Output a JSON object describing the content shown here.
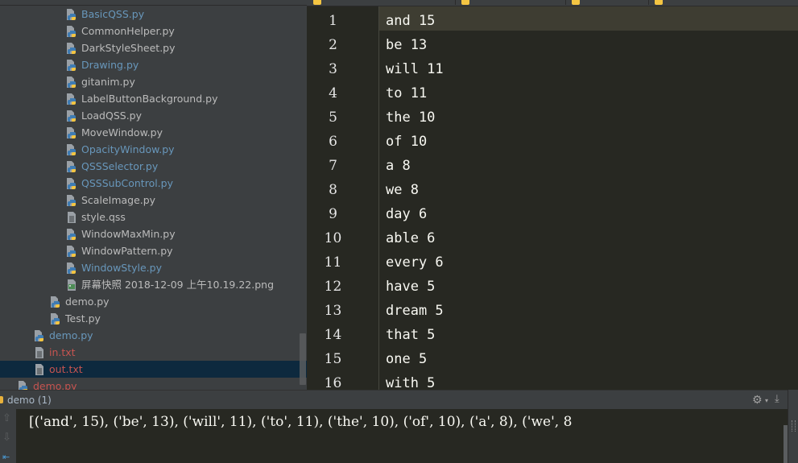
{
  "project_tree": {
    "items": [
      {
        "label": "BasicQSS.py",
        "icon": "python-file-icon",
        "status": "modified",
        "depth": 3
      },
      {
        "label": "CommonHelper.py",
        "icon": "python-file-icon",
        "status": "default",
        "depth": 3
      },
      {
        "label": "DarkStyleSheet.py",
        "icon": "python-file-icon",
        "status": "default",
        "depth": 3
      },
      {
        "label": "Drawing.py",
        "icon": "python-file-icon",
        "status": "modified",
        "depth": 3
      },
      {
        "label": "gitanim.py",
        "icon": "python-file-icon",
        "status": "default",
        "depth": 3
      },
      {
        "label": "LabelButtonBackground.py",
        "icon": "python-file-icon",
        "status": "default",
        "depth": 3
      },
      {
        "label": "LoadQSS.py",
        "icon": "python-file-icon",
        "status": "default",
        "depth": 3
      },
      {
        "label": "MoveWindow.py",
        "icon": "python-file-icon",
        "status": "default",
        "depth": 3
      },
      {
        "label": "OpacityWindow.py",
        "icon": "python-file-icon",
        "status": "modified",
        "depth": 3
      },
      {
        "label": "QSSSelector.py",
        "icon": "python-file-icon",
        "status": "modified",
        "depth": 3
      },
      {
        "label": "QSSSubControl.py",
        "icon": "python-file-icon",
        "status": "modified",
        "depth": 3
      },
      {
        "label": "ScaleImage.py",
        "icon": "python-file-icon",
        "status": "default",
        "depth": 3
      },
      {
        "label": "style.qss",
        "icon": "text-file-icon",
        "status": "default",
        "depth": 3
      },
      {
        "label": "WindowMaxMin.py",
        "icon": "python-file-icon",
        "status": "default",
        "depth": 3
      },
      {
        "label": "WindowPattern.py",
        "icon": "python-file-icon",
        "status": "default",
        "depth": 3
      },
      {
        "label": "WindowStyle.py",
        "icon": "python-file-icon",
        "status": "modified",
        "depth": 3
      },
      {
        "label": "屏幕快照 2018-12-09 上午10.19.22.png",
        "icon": "image-file-icon",
        "status": "default",
        "depth": 3
      },
      {
        "label": "demo.py",
        "icon": "python-file-icon",
        "status": "default",
        "depth": 2
      },
      {
        "label": "Test.py",
        "icon": "python-file-icon",
        "status": "default",
        "depth": 2
      },
      {
        "label": "demo.py",
        "icon": "python-file-icon",
        "status": "modified",
        "depth": 1
      },
      {
        "label": "in.txt",
        "icon": "text-file-icon",
        "status": "untracked",
        "depth": 1
      },
      {
        "label": "out.txt",
        "icon": "text-file-icon",
        "status": "untracked",
        "depth": 1,
        "selected": true
      },
      {
        "label": "demo.py",
        "icon": "python-file-icon",
        "status": "untracked",
        "depth": 0
      }
    ]
  },
  "colors": {
    "modified": "#6897bb",
    "untracked": "#c75450",
    "default": "#bbbbbb",
    "selection": "#0d293e",
    "editor_bg": "#272822",
    "current_line": "#3e3d32"
  },
  "editor": {
    "file": "out.txt",
    "lines": [
      {
        "n": "1",
        "text": "and 15"
      },
      {
        "n": "2",
        "text": "be 13"
      },
      {
        "n": "3",
        "text": "will 11"
      },
      {
        "n": "4",
        "text": "to 11"
      },
      {
        "n": "5",
        "text": "the 10"
      },
      {
        "n": "6",
        "text": "of 10"
      },
      {
        "n": "7",
        "text": "a 8"
      },
      {
        "n": "8",
        "text": "we 8"
      },
      {
        "n": "9",
        "text": "day 6"
      },
      {
        "n": "10",
        "text": "able 6"
      },
      {
        "n": "11",
        "text": "every 6"
      },
      {
        "n": "12",
        "text": "have 5"
      },
      {
        "n": "13",
        "text": "dream 5"
      },
      {
        "n": "14",
        "text": "that 5"
      },
      {
        "n": "15",
        "text": "one 5"
      },
      {
        "n": "16",
        "text": "with 5"
      }
    ]
  },
  "run_panel": {
    "title": "demo (1)",
    "output": "[('and', 15), ('be', 13), ('will', 11), ('to', 11), ('the', 10), ('of', 10), ('a', 8), ('we', 8",
    "icons": {
      "settings": "gear-icon",
      "download": "download-icon",
      "up": "arrow-up-icon",
      "down": "arrow-down-icon",
      "wrap": "soft-wrap-icon"
    }
  }
}
